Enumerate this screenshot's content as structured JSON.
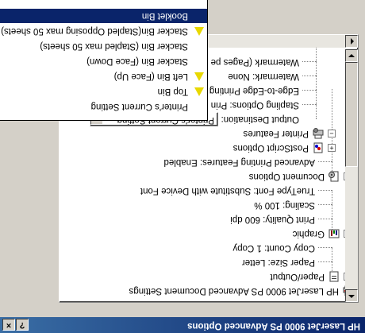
{
  "window": {
    "title": "HP LaserJet 9000 PS Advanced Options",
    "help_button": "?",
    "close_button": "×"
  },
  "tree": {
    "root": "HP LaserJet 9000 PS Advanced Document Settings",
    "paper_output": {
      "label": "Paper/Output",
      "items": [
        "Paper Size: Letter",
        "Copy Count: 1 Copy"
      ]
    },
    "graphic": {
      "label": "Graphic",
      "items": [
        "Print Quality: 600 dpi",
        "Scaling: 100 %",
        "TrueType Font: Substitute with Device Font"
      ]
    },
    "document_options": {
      "label": "Document Options",
      "items": [
        "Advanced Printing Features: Enabled",
        "PostScript Options",
        "Printer Features"
      ]
    },
    "printer_features": {
      "output_destination_label": "Output Destination:",
      "output_destination_value": "Printer's Current Setting",
      "items": [
        "Stapling Options: Prin",
        "Edge-to-Edge Printing",
        "Watermark: None",
        "Watermark (Pages pe"
      ]
    }
  },
  "dropdown": {
    "options": [
      {
        "label": "Printer's Current Setting",
        "warn": false,
        "selected": false
      },
      {
        "label": "Top Bin",
        "warn": true,
        "selected": false
      },
      {
        "label": "Left Bin (Face Up)",
        "warn": true,
        "selected": false
      },
      {
        "label": "Stacker Bin (Face Down)",
        "warn": false,
        "selected": false
      },
      {
        "label": "Stacker Bin (Stapled max 50 sheets)",
        "warn": false,
        "selected": false
      },
      {
        "label": "Stacker Bin(Stapled Opposing max 50 sheets)",
        "warn": true,
        "selected": false
      },
      {
        "label": "Booklet Bin",
        "warn": false,
        "selected": true
      }
    ]
  },
  "colors": {
    "selection": "#0a246a",
    "titlebar": "#0a246a",
    "warning": "#e8d800"
  }
}
